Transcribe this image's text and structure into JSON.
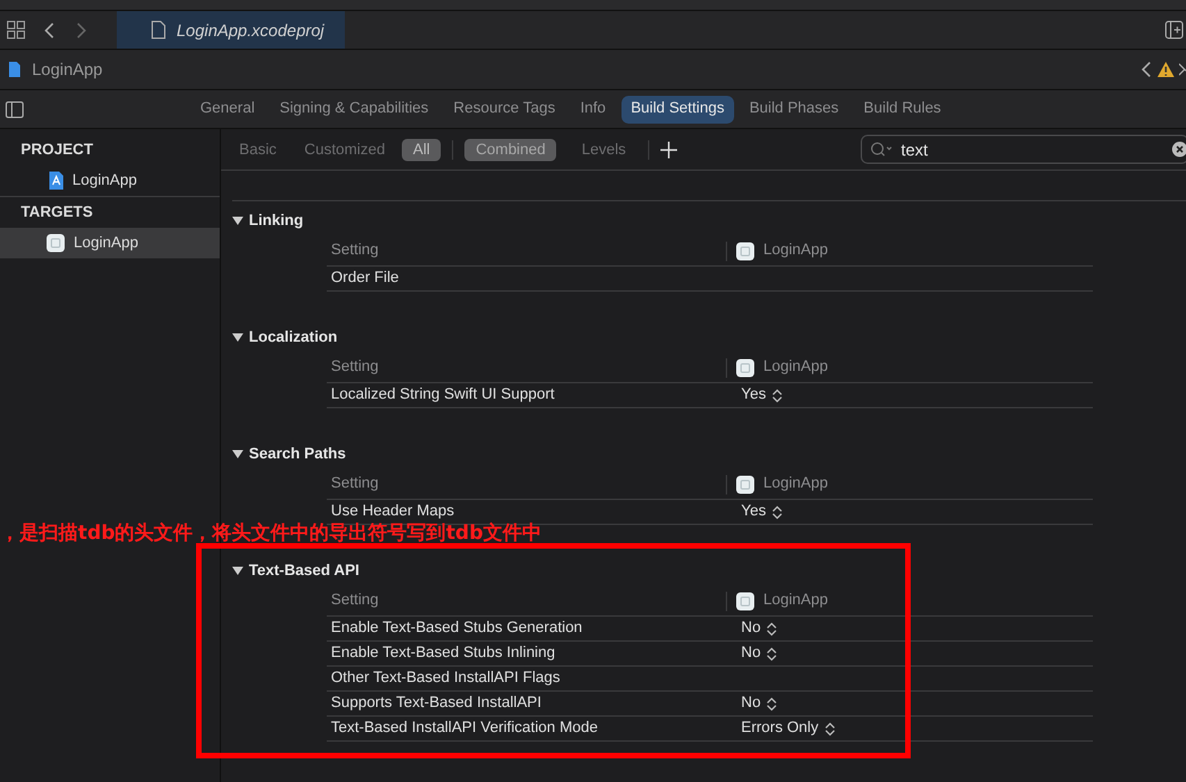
{
  "tab_bar": {
    "file_tab": "LoginApp.xcodeproj"
  },
  "breadcrumb": {
    "item": "LoginApp"
  },
  "editor_tabs": [
    {
      "label": "General",
      "selected": false
    },
    {
      "label": "Signing & Capabilities",
      "selected": false
    },
    {
      "label": "Resource Tags",
      "selected": false
    },
    {
      "label": "Info",
      "selected": false
    },
    {
      "label": "Build Settings",
      "selected": true
    },
    {
      "label": "Build Phases",
      "selected": false
    },
    {
      "label": "Build Rules",
      "selected": false
    }
  ],
  "sidebar": {
    "groups": [
      {
        "title": "PROJECT",
        "items": [
          {
            "label": "LoginApp",
            "kind": "project",
            "selected": false
          }
        ]
      },
      {
        "title": "TARGETS",
        "items": [
          {
            "label": "LoginApp",
            "kind": "target",
            "selected": true
          }
        ]
      }
    ]
  },
  "filter_bar": {
    "scopes": [
      {
        "label": "Basic",
        "selected": false
      },
      {
        "label": "Customized",
        "selected": false
      },
      {
        "label": "All",
        "selected": true
      }
    ],
    "views": [
      {
        "label": "Combined",
        "selected": true
      },
      {
        "label": "Levels",
        "selected": false
      }
    ],
    "search": {
      "value": "text"
    }
  },
  "sections": [
    {
      "title": "Linking",
      "expanded": true,
      "column_header": "Setting",
      "target": "LoginApp",
      "rows": [
        {
          "setting": "Order File"
        }
      ]
    },
    {
      "title": "Localization",
      "expanded": true,
      "column_header": "Setting",
      "target": "LoginApp",
      "rows": [
        {
          "setting": "Localized String Swift UI Support",
          "value": "Yes"
        }
      ]
    },
    {
      "title": "Search Paths",
      "expanded": true,
      "column_header": "Setting",
      "target": "LoginApp",
      "rows": [
        {
          "setting": "Use Header Maps",
          "value": "Yes"
        }
      ]
    },
    {
      "title": "Text-Based API",
      "expanded": true,
      "column_header": "Setting",
      "target": "LoginApp",
      "rows": [
        {
          "setting": "Enable Text-Based Stubs Generation",
          "value": "No"
        },
        {
          "setting": "Enable Text-Based Stubs Inlining",
          "value": "No"
        },
        {
          "setting": "Other Text-Based InstallAPI Flags"
        },
        {
          "setting": "Supports Text-Based InstallAPI",
          "value": "No"
        },
        {
          "setting": "Text-Based InstallAPI Verification Mode",
          "value": "Errors Only"
        }
      ]
    }
  ],
  "annotation": {
    "text": "，是扫描tdb的头文件，将头文件中的导出符号写到tdb文件中"
  }
}
